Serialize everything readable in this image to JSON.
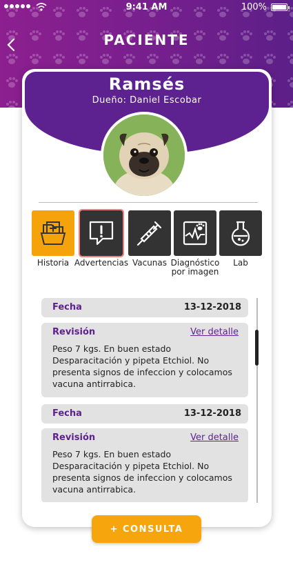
{
  "status_bar": {
    "time": "9:41 AM",
    "battery": "100%"
  },
  "header": {
    "title": "PACIENTE",
    "back_icon": "chevron-left-icon"
  },
  "patient": {
    "name": "Ramsés",
    "owner": "Dueño: Daniel Escobar"
  },
  "menu": [
    {
      "label": "Historia",
      "icon": "clinical-folder-icon",
      "active": true
    },
    {
      "label": "Advertencias",
      "icon": "warning-chat-icon",
      "active": false
    },
    {
      "label": "Vacunas",
      "icon": "syringe-icon",
      "active": false
    },
    {
      "label": "Diagnóstico por imagen",
      "icon": "xray-paw-icon",
      "active": false
    },
    {
      "label": "Lab",
      "icon": "flask-icon",
      "active": false
    }
  ],
  "records": [
    {
      "date_label": "Fecha",
      "date": "13-12-2018",
      "review_label": "Revisión",
      "link": "Ver detalle",
      "text": "Peso 7 kgs. En buen estado Desparacitación y pipeta Etchiol. No presenta signos de infeccion y colocamos vacuna antirrabica."
    },
    {
      "date_label": "Fecha",
      "date": "13-12-2018",
      "review_label": "Revisión",
      "link": "Ver detalle",
      "text": "Peso 7 kgs. En buen estado Desparacitación y pipeta Etchiol. No presenta signos de infeccion y colocamos vacuna antirrabica."
    }
  ],
  "cta": "+ CONSULTA",
  "colors": {
    "purple": "#5e2190",
    "orange": "#f5a30b"
  }
}
